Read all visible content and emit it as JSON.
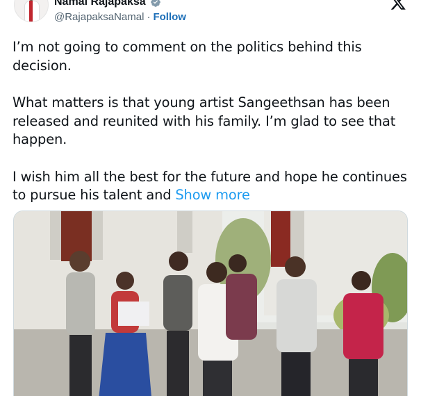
{
  "author": {
    "display_name": "Namal Rajapaksa",
    "handle": "@RajapaksaNamal",
    "separator": "·",
    "follow_label": "Follow",
    "verified_color": "#829aab"
  },
  "tweet": {
    "paragraphs": [
      "I’m not going to comment on the politics behind this decision.",
      "What matters is that young artist Sangeethsan has been released and reunited with his family. I’m glad to see that happen.",
      "I wish him all the best for the future and hope he continues to pursue his talent and"
    ],
    "show_more_label": "Show more"
  },
  "media": {
    "kind": "photo",
    "subject": "group of people walking outdoors"
  },
  "colors": {
    "link": "#1d9bf0",
    "follow": "#1d6fb8",
    "text": "#0f1419",
    "muted": "#536471"
  },
  "icons": [
    "verified-badge-icon",
    "x-logo-icon"
  ]
}
